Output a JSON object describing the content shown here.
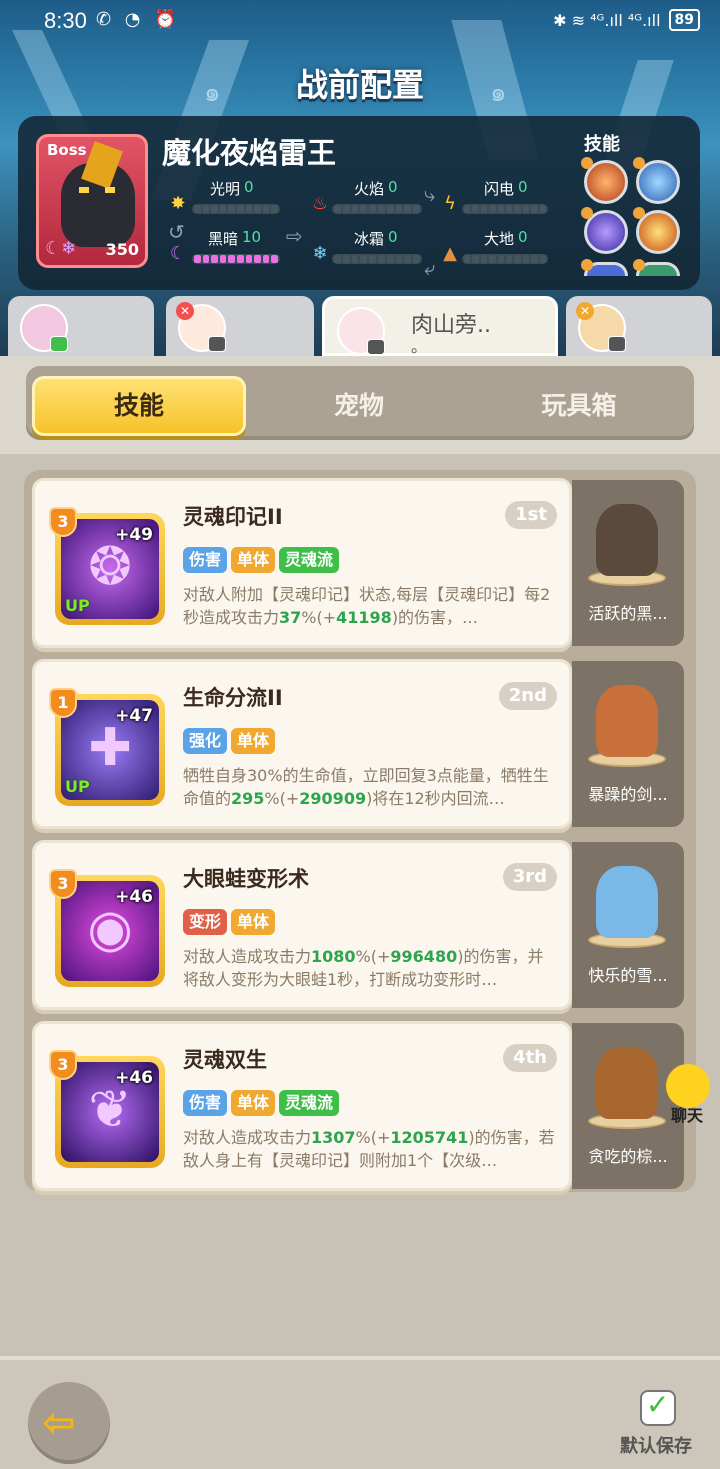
{
  "status": {
    "time": "8:30",
    "left_icons": "✆ ◔ ⏰",
    "right_icons": "✱ ≋ ⁴ᴳ.ıll ⁴ᴳ.ıll",
    "battery": "89"
  },
  "title": "战前配置",
  "boss": {
    "tag": "Boss",
    "name": "魔化夜焰雷王",
    "level": "350",
    "stats": [
      {
        "label": "光明",
        "value": "0",
        "icon": "sun-icon",
        "glyph": "✸",
        "color": "#ffd43b",
        "fill": 0
      },
      {
        "label": "火焰",
        "value": "0",
        "icon": "fire-icon",
        "glyph": "♨",
        "color": "#ff4b2b",
        "fill": 0
      },
      {
        "label": "闪电",
        "value": "0",
        "icon": "lightning-icon",
        "glyph": "ϟ",
        "color": "#ffc42e",
        "fill": 0
      },
      {
        "label": "黑暗",
        "value": "10",
        "icon": "moon-icon",
        "glyph": "☾",
        "color": "#c86bf0",
        "fill": 10
      },
      {
        "label": "冰霜",
        "value": "0",
        "icon": "snowflake-icon",
        "glyph": "❄",
        "color": "#7ad3ff",
        "fill": 0
      },
      {
        "label": "大地",
        "value": "0",
        "icon": "mountain-icon",
        "glyph": "▲",
        "color": "#e09040",
        "fill": 0
      }
    ],
    "skills_label": "技能"
  },
  "team": [
    {
      "name": "",
      "dot": ""
    },
    {
      "name": "",
      "dot": ""
    },
    {
      "name": "肉山旁..",
      "dot": "。"
    },
    {
      "name": "",
      "dot": ""
    }
  ],
  "tabs": [
    "技能",
    "宠物",
    "玩具箱"
  ],
  "skills": [
    {
      "level": "3",
      "plus": "+49",
      "up": "UP",
      "name": "灵魂印记II",
      "rank": "1st",
      "tags": [
        {
          "text": "伤害",
          "color": "#5aa3e6"
        },
        {
          "text": "单体",
          "color": "#f0a830"
        },
        {
          "text": "灵魂流",
          "color": "#3fbf4a"
        }
      ],
      "desc": [
        "对敌人附加【灵魂印记】状态,每层【灵魂印记】每2秒造成攻击力",
        "37",
        "%(+",
        "41198",
        ")的伤害，…"
      ],
      "pet": "活跃的黑..."
    },
    {
      "level": "1",
      "plus": "+47",
      "up": "UP",
      "name": "生命分流II",
      "rank": "2nd",
      "tags": [
        {
          "text": "强化",
          "color": "#5aa3e6"
        },
        {
          "text": "单体",
          "color": "#f0a830"
        }
      ],
      "desc": [
        "牺牲自身30%的生命值，立即回复3点能量，牺牲生命值的",
        "295",
        "%(+",
        "290909",
        ")将在12秒内回流…"
      ],
      "pet": "暴躁的剑..."
    },
    {
      "level": "3",
      "plus": "+46",
      "up": "",
      "name": "大眼蛙变形术",
      "rank": "3rd",
      "tags": [
        {
          "text": "变形",
          "color": "#e0604a"
        },
        {
          "text": "单体",
          "color": "#f0a830"
        }
      ],
      "desc": [
        "对敌人造成攻击力",
        "1080",
        "%(+",
        "996480",
        ")的伤害，并将敌人变形为大眼蛙1秒，打断成功变形时…"
      ],
      "pet": "快乐的雪..."
    },
    {
      "level": "3",
      "plus": "+46",
      "up": "",
      "name": "灵魂双生",
      "rank": "4th",
      "tags": [
        {
          "text": "伤害",
          "color": "#5aa3e6"
        },
        {
          "text": "单体",
          "color": "#f0a830"
        },
        {
          "text": "灵魂流",
          "color": "#3fbf4a"
        }
      ],
      "desc": [
        "对敌人造成攻击力",
        "1307",
        "%(+",
        "1205741",
        ")的伤害，若敌人身上有【灵魂印记】则附加1个【次级…"
      ],
      "pet": "贪吃的棕..."
    }
  ],
  "chat_label": "聊天",
  "save_label": "默认保存"
}
